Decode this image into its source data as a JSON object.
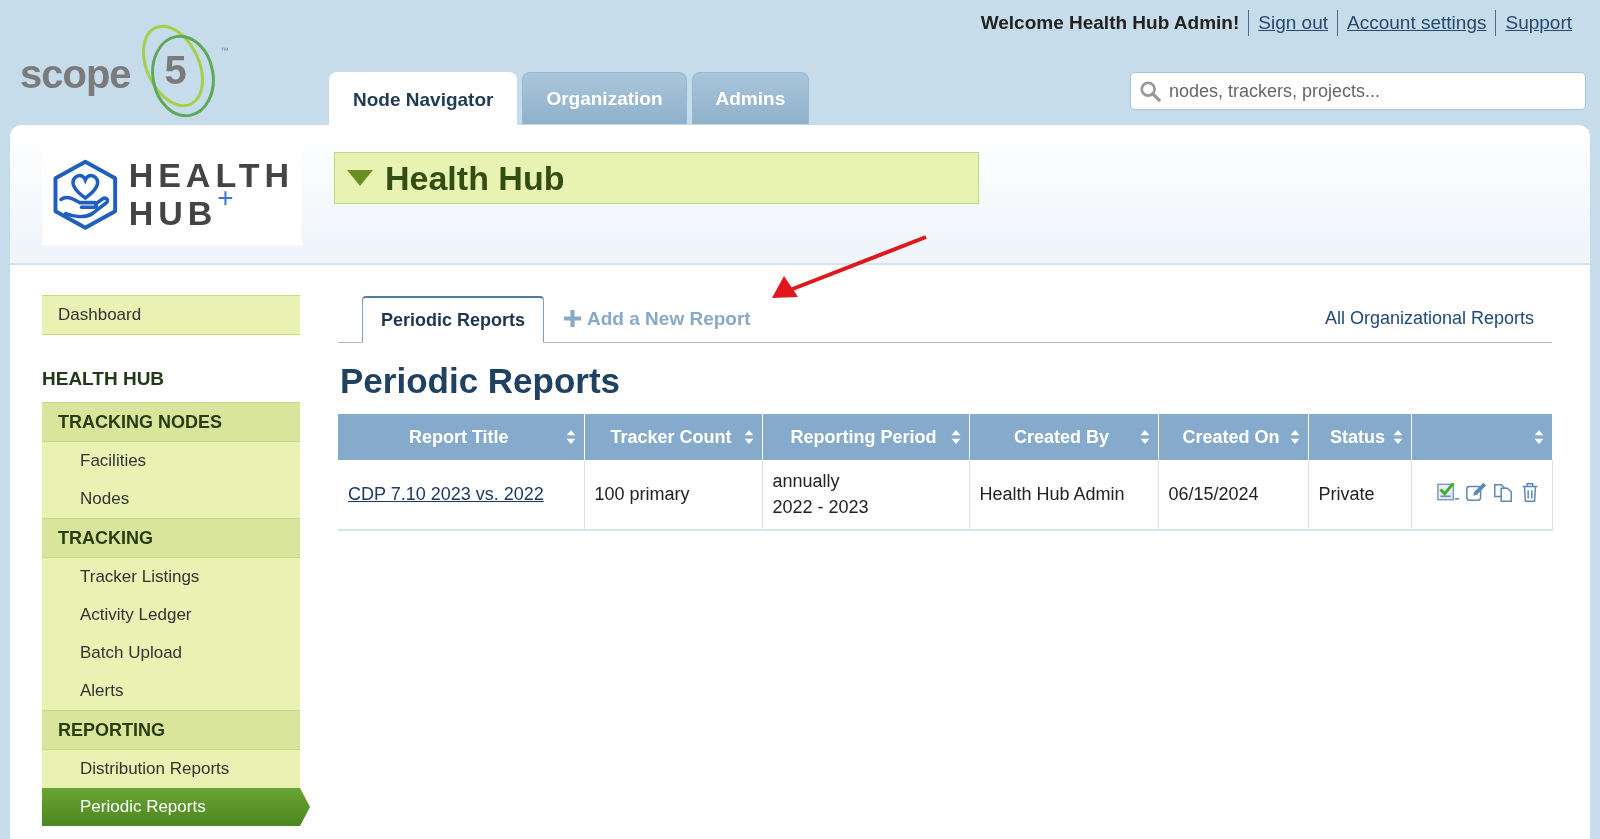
{
  "brand": {
    "word": "scope",
    "digit": "5",
    "tm": "™"
  },
  "user_bar": {
    "welcome": "Welcome Health Hub Admin!",
    "links": [
      "Sign out",
      "Account settings",
      "Support"
    ]
  },
  "tabs": [
    {
      "label": "Node Navigator",
      "selected": true
    },
    {
      "label": "Organization",
      "selected": false
    },
    {
      "label": "Admins",
      "selected": false
    }
  ],
  "search": {
    "placeholder": "nodes, trackers, projects..."
  },
  "org_logo": {
    "line1": "HEALTH",
    "line2": "HUB",
    "plus": "+"
  },
  "node_title": "Health Hub",
  "sidebar": {
    "dashboard": "Dashboard",
    "title": "HEALTH HUB",
    "groups": [
      {
        "label": "TRACKING NODES",
        "items": [
          {
            "label": "Facilities",
            "selected": false
          },
          {
            "label": "Nodes",
            "selected": false
          }
        ]
      },
      {
        "label": "TRACKING",
        "items": [
          {
            "label": "Tracker Listings",
            "selected": false
          },
          {
            "label": "Activity Ledger",
            "selected": false
          },
          {
            "label": "Batch Upload",
            "selected": false
          },
          {
            "label": "Alerts",
            "selected": false
          }
        ]
      },
      {
        "label": "REPORTING",
        "items": [
          {
            "label": "Distribution Reports",
            "selected": false
          },
          {
            "label": "Periodic Reports",
            "selected": true
          }
        ]
      }
    ]
  },
  "subtabs": [
    {
      "label": "Periodic Reports",
      "selected": true
    }
  ],
  "add_link": "Add a New Report",
  "all_link": "All Organizational Reports",
  "heading": "Periodic Reports",
  "table": {
    "columns": [
      "Report Title",
      "Tracker Count",
      "Reporting Period",
      "Created By",
      "Created On",
      "Status",
      ""
    ],
    "rows": [
      {
        "title": "CDP 7.10 2023 vs. 2022",
        "tracker_count": "100 primary",
        "period": [
          "annually",
          "2022 - 2023"
        ],
        "created_by": "Health Hub Admin",
        "created_on": "06/15/2024",
        "status": "Private"
      }
    ]
  }
}
